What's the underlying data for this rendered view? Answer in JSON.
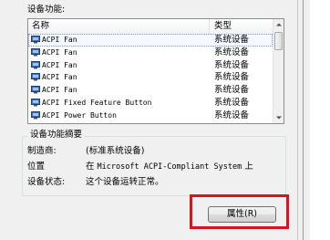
{
  "device_functions": {
    "section_label": "设备功能:",
    "columns": {
      "name": "名称",
      "type": "类型"
    },
    "rows": [
      {
        "name": "ACPI Fan",
        "type": "系统设备"
      },
      {
        "name": "ACPI Fan",
        "type": "系统设备"
      },
      {
        "name": "ACPI Fan",
        "type": "系统设备"
      },
      {
        "name": "ACPI Fan",
        "type": "系统设备"
      },
      {
        "name": "ACPI Fan",
        "type": "系统设备"
      },
      {
        "name": "ACPI Fixed Feature Button",
        "type": "系统设备"
      },
      {
        "name": "ACPI Power Button",
        "type": "系统设备"
      }
    ],
    "row_icon": "device-icon",
    "scroll_up_icon": "scroll-up-icon",
    "scroll_down_icon": "scroll-down-icon"
  },
  "summary": {
    "title": "设备功能摘要",
    "manufacturer_label": "制造商:",
    "manufacturer_value": "(标准系统设备)",
    "location_label": "位置",
    "location_prefix": "在",
    "location_value": "Microsoft ACPI-Compliant System",
    "location_suffix": "上",
    "status_label": "设备状态:",
    "status_value": "这个设备运转正常。"
  },
  "buttons": {
    "properties_label": "属性(R)"
  },
  "colors": {
    "highlight": "#d7141e",
    "dialog_bg": "#f0f0f0"
  }
}
